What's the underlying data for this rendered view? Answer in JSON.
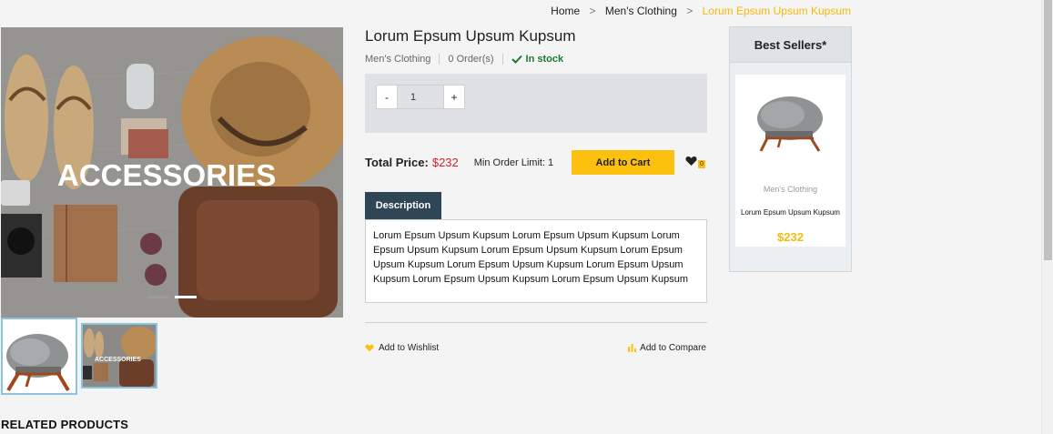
{
  "breadcrumb": {
    "home": "Home",
    "category": "Men's Clothing",
    "current": "Lorum Epsum Upsum Kupsum",
    "separator": ">"
  },
  "gallery": {
    "main_image_text": "ACCESSORIES",
    "thumb_2_text": "ACCESSORIES",
    "slides_count": 2,
    "active_slide": 2
  },
  "product": {
    "title": "Lorum Epsum Upsum Kupsum",
    "category": "Men's Clothing",
    "orders": "0 Order(s)",
    "stock": "In stock",
    "quantity": "1",
    "qty_minus": "-",
    "qty_plus": "+",
    "total_label": "Total Price:",
    "total_price": "$232",
    "min_order": "Min Order Limit: 1",
    "add_to_cart": "Add to Cart",
    "wishlist_count": "0",
    "description_tab": "Description",
    "description": "Lorum Epsum Upsum Kupsum Lorum Epsum Upsum Kupsum Lorum Epsum Upsum Kupsum Lorum Epsum Upsum Kupsum Lorum Epsum Upsum Kupsum Lorum Epsum Upsum Kupsum Lorum Epsum Upsum Kupsum Lorum Epsum Upsum Kupsum Lorum Epsum Upsum Kupsum",
    "add_to_wishlist": "Add to Wishlist",
    "add_to_compare": "Add to Compare"
  },
  "best_sellers": {
    "title": "Best Sellers*",
    "items": [
      {
        "category": "Men's Clothing",
        "name": "Lorum Epsum Upsum Kupsum",
        "price": "$232"
      }
    ]
  },
  "related": {
    "title": "RELATED PRODUCTS"
  },
  "colors": {
    "accent": "#fcc10f",
    "price_red": "#d0202a",
    "tab_dark": "#2e4656",
    "breadcrumb_active": "#f6b90a",
    "stock_green": "#1d7a2e"
  }
}
